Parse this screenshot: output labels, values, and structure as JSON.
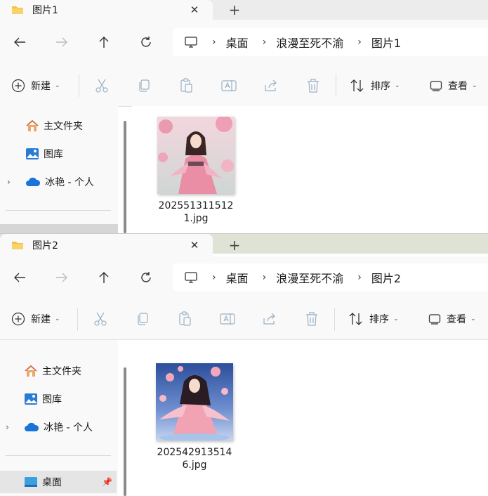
{
  "windows": [
    {
      "tab_title": "图片1",
      "breadcrumb": [
        "桌面",
        "浪漫至死不渝",
        "图片1"
      ],
      "commands": {
        "new_label": "新建",
        "sort_label": "排序",
        "view_label": "查看"
      },
      "nav": {
        "home": "主文件夹",
        "gallery": "图库",
        "onedrive": "冰艳 - 个人"
      },
      "file": {
        "name_line1": "202551311512",
        "name_line2": "1.jpg"
      }
    },
    {
      "tab_title": "图片2",
      "breadcrumb": [
        "桌面",
        "浪漫至死不渝",
        "图片2"
      ],
      "commands": {
        "new_label": "新建",
        "sort_label": "排序",
        "view_label": "查看"
      },
      "nav": {
        "home": "主文件夹",
        "gallery": "图库",
        "onedrive": "冰艳 - 个人",
        "desktop": "桌面"
      },
      "file": {
        "name_line1": "202542913514",
        "name_line2": "6.jpg"
      }
    }
  ],
  "colors": {
    "folder": "#f4c146",
    "accent": "#0067c0",
    "onedrive": "#1a73d9"
  },
  "icons": [
    "folder-icon",
    "close-icon",
    "plus-icon",
    "back-arrow-icon",
    "forward-arrow-icon",
    "up-arrow-icon",
    "refresh-icon",
    "computer-icon",
    "chevron-right-icon",
    "cut-icon",
    "copy-icon",
    "paste-icon",
    "rename-icon",
    "share-icon",
    "delete-icon",
    "sort-icon",
    "view-icon",
    "home-icon",
    "gallery-icon",
    "onedrive-icon",
    "desktop-icon",
    "pin-icon"
  ]
}
